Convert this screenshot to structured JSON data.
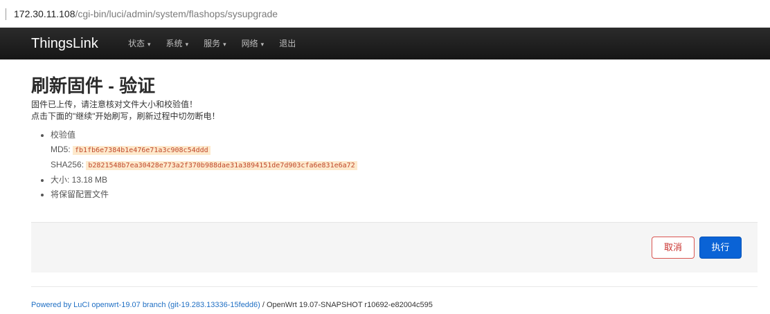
{
  "address_bar": {
    "host": "172.30.11.108",
    "path": "/cgi-bin/luci/admin/system/flashops/sysupgrade"
  },
  "navbar": {
    "brand": "ThingsLink",
    "menu": [
      {
        "label": "状态",
        "caret": "▾"
      },
      {
        "label": "系统",
        "caret": "▾"
      },
      {
        "label": "服务",
        "caret": "▾"
      },
      {
        "label": "网络",
        "caret": "▾"
      },
      {
        "label": "退出",
        "caret": ""
      }
    ]
  },
  "main": {
    "title": "刷新固件 - 验证",
    "description_line1": "固件已上传，请注意核对文件大小和校验值！",
    "description_line2": "点击下面的\"继续\"开始刷写，刷新过程中切勿断电！",
    "checksum_label": "校验值",
    "md5_label": "MD5:",
    "md5_value": "fb1fb6e7384b1e476e71a3c908c54ddd",
    "sha256_label": "SHA256:",
    "sha256_value": "b2821548b7ea30428e773a2f370b988dae31a3894151de7d903cfa6e831e6a72",
    "size_text": "大小: 13.18 MB",
    "keep_config_text": "将保留配置文件"
  },
  "actions": {
    "cancel_label": "取消",
    "apply_label": "执行"
  },
  "footer": {
    "link_text": "Powered by LuCI openwrt-19.07 branch (git-19.283.13336-15fedd6)",
    "rest_text": " / OpenWrt 19.07-SNAPSHOT r10692-e82004c595"
  },
  "colors": {
    "navbar_bg": "#1e1e1e",
    "primary_button": "#0a63d6",
    "cancel_button_border": "#d9534f",
    "code_highlight": "#fde9cc",
    "link": "#1f6fc4"
  }
}
